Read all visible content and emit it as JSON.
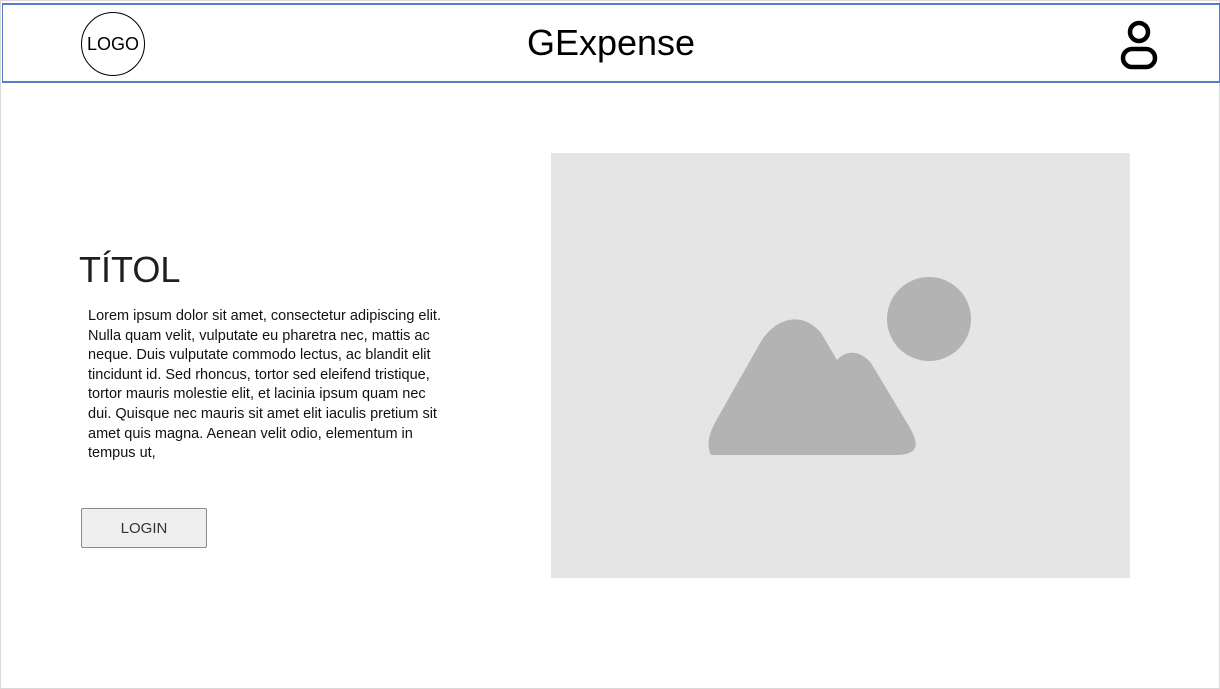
{
  "header": {
    "logo_label": "LOGO",
    "app_title": "GExpense",
    "user_icon": "user-icon"
  },
  "main": {
    "title": "TÍTOL",
    "description": "Lorem ipsum dolor sit amet, consectetur adipiscing elit. Nulla quam velit, vulputate eu pharetra nec, mattis ac neque. Duis vulputate commodo lectus, ac blandit elit tincidunt id. Sed rhoncus, tortor sed eleifend tristique, tortor mauris molestie elit, et lacinia ipsum quam nec dui. Quisque nec mauris sit amet elit iaculis pretium sit amet quis magna. Aenean velit odio, elementum in tempus ut,",
    "login_label": "LOGIN",
    "image_icon": "image-placeholder-icon"
  },
  "colors": {
    "header_border": "#5b7bc9",
    "placeholder_bg": "#e5e5e5",
    "placeholder_shape": "#b3b3b3",
    "button_bg": "#efefef"
  }
}
